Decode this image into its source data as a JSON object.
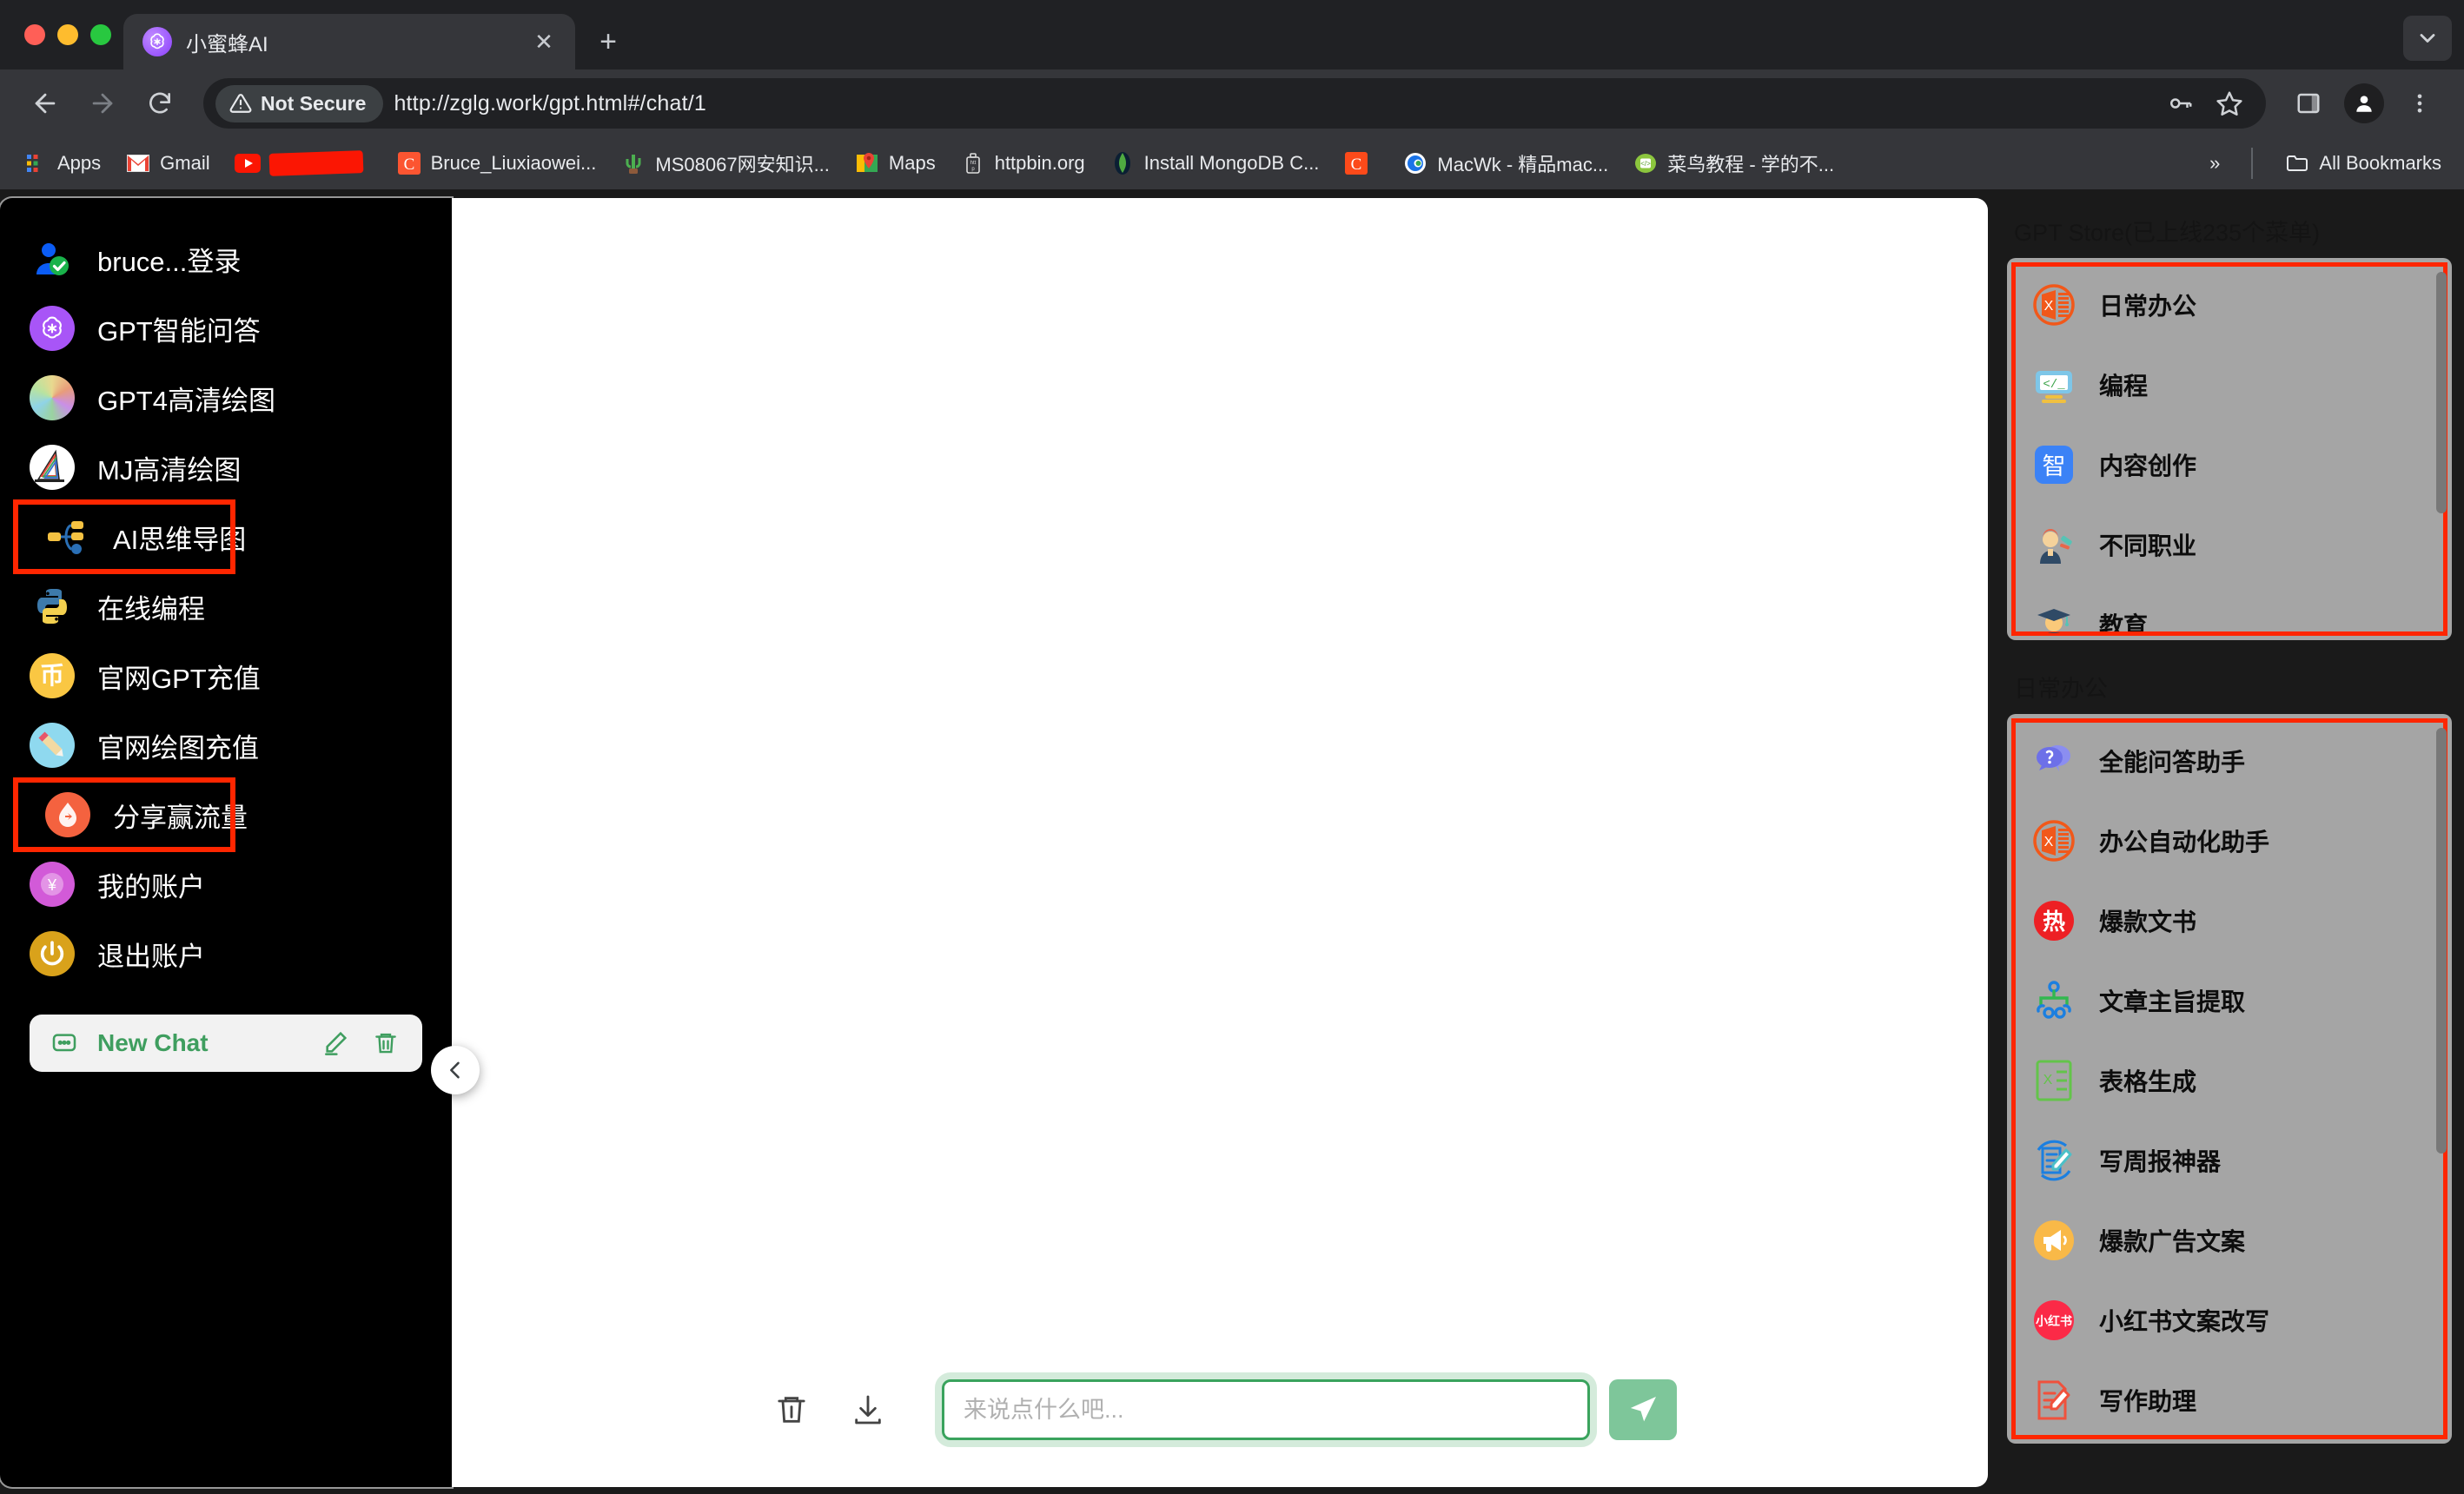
{
  "browser": {
    "tab": {
      "title": "小蜜蜂AI",
      "favicon": "openai-logo-icon",
      "close": "✕"
    },
    "new_tab_label": "+",
    "tab_list_chevron": "chevron-down-icon",
    "toolbar": {
      "back": "←",
      "forward": "→",
      "reload": "⟳",
      "security_label": "Not Secure",
      "url": "http://zglg.work/gpt.html#/chat/1",
      "password_icon": "key-icon",
      "bookmark_icon": "star-icon",
      "sidepanel_icon": "side-panel-icon",
      "profile_icon": "profile-avatar-icon",
      "menu_icon": "three-dot-menu-icon"
    },
    "bookmarks": [
      {
        "label": "Apps",
        "icon": "apps-grid-icon"
      },
      {
        "label": "Gmail",
        "icon": "gmail-icon"
      },
      {
        "label": "",
        "icon": "youtube-icon-redacted"
      },
      {
        "label": "Bruce_Liuxiaowei...",
        "icon": "csdn-icon"
      },
      {
        "label": "MS08067网安知识...",
        "icon": "cactus-icon"
      },
      {
        "label": "Maps",
        "icon": "google-maps-icon"
      },
      {
        "label": "httpbin.org",
        "icon": "httpbin-icon"
      },
      {
        "label": "Install MongoDB C...",
        "icon": "mongodb-icon"
      },
      {
        "label": "",
        "icon": "csdn-orange-icon"
      },
      {
        "label": "MacWk - 精品mac...",
        "icon": "macwk-icon"
      },
      {
        "label": "菜鸟教程 - 学的不...",
        "icon": "runoob-icon"
      }
    ],
    "overflow_label": "»",
    "all_bookmarks_label": "All Bookmarks",
    "all_bookmarks_icon": "folder-icon"
  },
  "sidebar": {
    "items": [
      {
        "label": "bruce...登录",
        "icon": "user-verified-icon",
        "highlighted": false
      },
      {
        "label": "GPT智能问答",
        "icon": "openai-logo-icon",
        "highlighted": false
      },
      {
        "label": "GPT4高清绘图",
        "icon": "color-wheel-icon",
        "highlighted": false
      },
      {
        "label": "MJ高清绘图",
        "icon": "midjourney-sail-icon",
        "highlighted": false
      },
      {
        "label": "AI思维导图",
        "icon": "mindmap-icon",
        "highlighted": true
      },
      {
        "label": "在线编程",
        "icon": "python-icon",
        "highlighted": false
      },
      {
        "label": "官网GPT充值",
        "icon": "coin-icon",
        "highlighted": false
      },
      {
        "label": "官网绘图充值",
        "icon": "pencil-icon",
        "highlighted": false
      },
      {
        "label": "分享赢流量",
        "icon": "share-drop-icon",
        "highlighted": true
      },
      {
        "label": "我的账户",
        "icon": "yen-account-icon",
        "highlighted": false
      },
      {
        "label": "退出账户",
        "icon": "power-off-icon",
        "highlighted": false
      }
    ],
    "new_chat": {
      "label": "New Chat",
      "chat_icon": "chat-bubble-icon",
      "edit_icon": "pencil-edit-icon",
      "delete_icon": "trash-icon"
    },
    "collapse_icon": "chevron-left-icon"
  },
  "composer": {
    "clear_icon": "trash-icon",
    "download_icon": "download-icon",
    "placeholder": "来说点什么吧...",
    "value": "",
    "send_icon": "send-paper-plane-icon"
  },
  "right_panel": {
    "sections": [
      {
        "heading": "GPT Store(已上线235个菜单)",
        "items": [
          {
            "label": "日常办公",
            "icon": "excel-icon"
          },
          {
            "label": "编程",
            "icon": "code-monitor-icon"
          },
          {
            "label": "内容创作",
            "icon": "zhi-square-icon"
          },
          {
            "label": "不同职业",
            "icon": "judge-person-icon"
          },
          {
            "label": "教育",
            "icon": "graduate-person-icon"
          }
        ]
      },
      {
        "heading": "日常办公",
        "items": [
          {
            "label": "全能问答助手",
            "icon": "question-bubble-icon"
          },
          {
            "label": "办公自动化助手",
            "icon": "excel-icon"
          },
          {
            "label": "爆款文书",
            "icon": "hot-red-icon"
          },
          {
            "label": "文章主旨提取",
            "icon": "hierarchy-icon"
          },
          {
            "label": "表格生成",
            "icon": "spreadsheet-green-icon"
          },
          {
            "label": "写周报神器",
            "icon": "doc-pencil-blue-icon"
          },
          {
            "label": "爆款广告文案",
            "icon": "megaphone-icon"
          },
          {
            "label": "小红书文案改写",
            "icon": "xiaohongshu-icon"
          },
          {
            "label": "写作助理",
            "icon": "doc-pencil-red-icon"
          }
        ]
      }
    ]
  },
  "colors": {
    "highlight": "#ff2600",
    "accent_green": "#3aa35d",
    "card_gray": "#a5a5a5",
    "sidebar_bg": "#000000",
    "panel_bg": "#1a1a1a"
  }
}
